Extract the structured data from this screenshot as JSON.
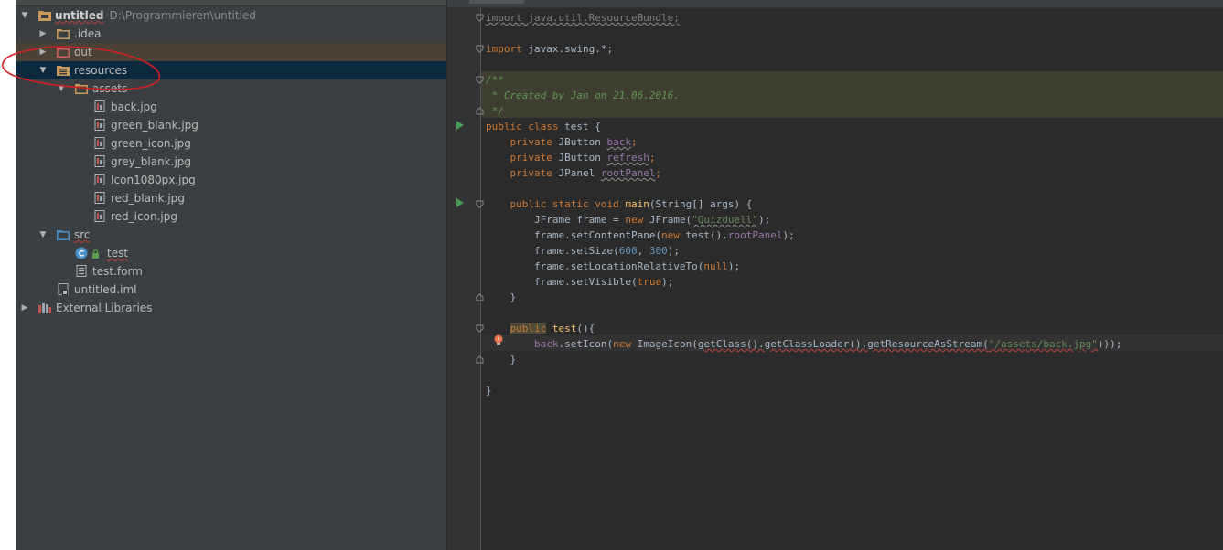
{
  "project_tree": {
    "root": {
      "name": "untitled",
      "path": "D:\\Programmieren\\untitled"
    },
    "items": [
      {
        "label": ".idea"
      },
      {
        "label": "out"
      },
      {
        "label": "resources"
      },
      {
        "label": "assets"
      },
      {
        "label": "back.jpg"
      },
      {
        "label": "green_blank.jpg"
      },
      {
        "label": "green_icon.jpg"
      },
      {
        "label": "grey_blank.jpg"
      },
      {
        "label": "Icon1080px.jpg"
      },
      {
        "label": "red_blank.jpg"
      },
      {
        "label": "red_icon.jpg"
      },
      {
        "label": "src"
      },
      {
        "label": "test"
      },
      {
        "label": "test.form"
      },
      {
        "label": "untitled.iml"
      },
      {
        "label": "External Libraries"
      }
    ]
  },
  "code": {
    "import1": "import java.util.ResourceBundle;",
    "import2_kw": "import",
    "import2_rest": " javax.swing.*;",
    "doc_open": "/**",
    "doc_body": " * Created by Jan on 21.06.2016.",
    "doc_close": " */",
    "class_kw": "public class",
    "class_name": " test {",
    "f1_kw": "private",
    "f1_type": " JButton ",
    "f1_name": "back",
    "f2_kw": "private",
    "f2_type": " JButton ",
    "f2_name": "refresh",
    "f3_kw": "private",
    "f3_type": " JPanel ",
    "f3_name": "rootPanel",
    "main_kw": "public static void ",
    "main_name": "main",
    "main_args": "(String[] args) {",
    "l_frame_a": "JFrame frame = ",
    "l_frame_new": "new",
    "l_frame_b": " JFrame(",
    "l_frame_str": "\"Quizduell\"",
    "l_frame_c": ");",
    "l_content_a": "frame.setContentPane(",
    "l_content_new": "new",
    "l_content_b": " test().",
    "l_content_fld": "rootPanel",
    "l_content_c": ");",
    "l_size_a": "frame.setSize(",
    "l_size_n1": "600",
    "l_size_sep": ", ",
    "l_size_n2": "300",
    "l_size_c": ");",
    "l_loc_a": "frame.setLocationRelativeTo(",
    "l_loc_null": "null",
    "l_loc_c": ");",
    "l_vis_a": "frame.setVisible(",
    "l_vis_true": "true",
    "l_vis_c": ");",
    "close_brace_inner": "}",
    "ctor_kw": "public",
    "ctor_name": "test",
    "ctor_rest": "(){",
    "icon_fld": "back",
    "icon_a": ".setIcon(",
    "icon_new": "new",
    "icon_b": " ImageIcon(",
    "icon_c": "getClass().getClassLoader().getResourceAsStream(",
    "icon_str": "\"/assets/back.jpg\"",
    "icon_end": ")));",
    "close_brace_ctor": "}",
    "close_brace_class": "}"
  },
  "colors": {
    "panel_bg": "#3c3f41",
    "editor_bg": "#2b2b2b",
    "selection": "#0d293e",
    "annotation": "#d21f24"
  }
}
